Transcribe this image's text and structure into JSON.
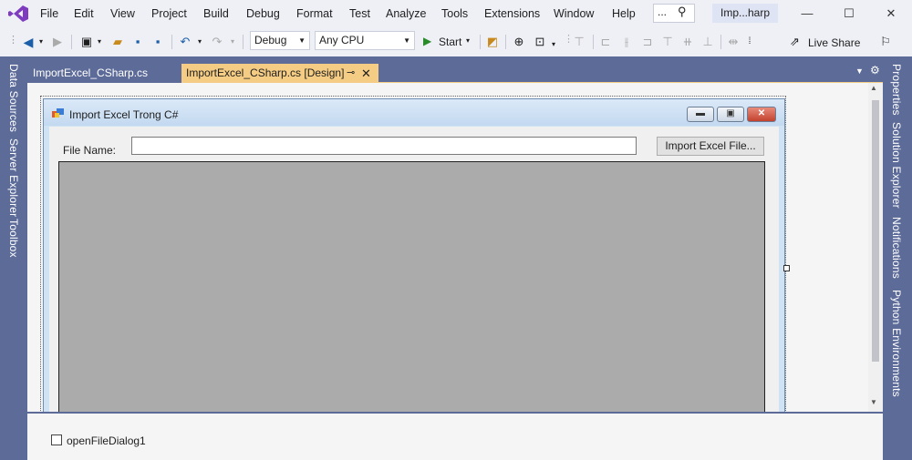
{
  "menu": {
    "items": [
      "File",
      "Edit",
      "View",
      "Project",
      "Build",
      "Debug",
      "Format",
      "Test",
      "Analyze",
      "Tools",
      "Extensions",
      "Window",
      "Help"
    ],
    "search_dots": "...",
    "title_badge": "Imp...harp"
  },
  "window_controls": {
    "minimize": "—",
    "maximize": "☐",
    "close": "✕"
  },
  "toolbar": {
    "config": "Debug",
    "platform": "Any CPU",
    "start": "Start",
    "live_share": "Live Share"
  },
  "left_rail": [
    "Data Sources",
    "Server Explorer",
    "Toolbox"
  ],
  "right_rail": [
    "Properties",
    "Solution Explorer",
    "Notifications",
    "Python Environments"
  ],
  "tabs": [
    {
      "label": "ImportExcel_CSharp.cs",
      "active": false
    },
    {
      "label": "ImportExcel_CSharp.cs [Design]",
      "active": true
    }
  ],
  "form": {
    "title": "Import Excel Trong C#",
    "file_name_label": "File Name:",
    "file_name_value": "",
    "import_button": "Import Excel File..."
  },
  "tray": {
    "component": "openFileDialog1"
  },
  "colors": {
    "rail": "#5d6b99",
    "active_tab": "#f5cc84",
    "grid": "#ababab",
    "accent": "#68217a"
  }
}
